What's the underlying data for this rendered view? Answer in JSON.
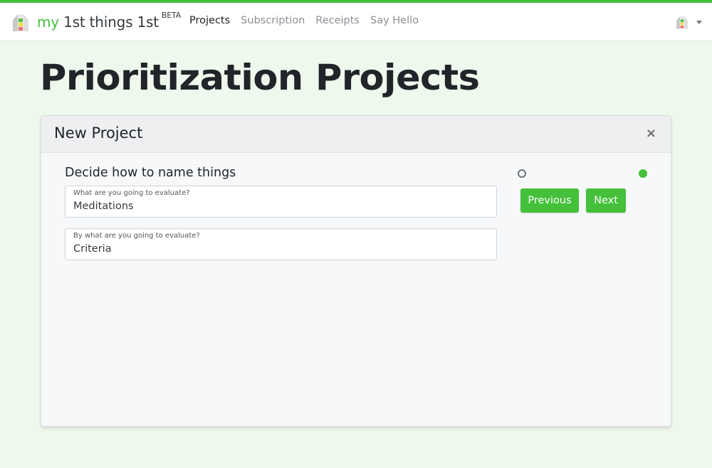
{
  "brand": {
    "prefix": "my",
    "name": " 1st things 1st",
    "badge": "BETA"
  },
  "nav": {
    "items": [
      {
        "label": "Projects",
        "active": true
      },
      {
        "label": "Subscription",
        "active": false
      },
      {
        "label": "Receipts",
        "active": false
      },
      {
        "label": "Say Hello",
        "active": false
      }
    ]
  },
  "colors": {
    "accent": "#44c03a",
    "page_bg": "#eef8ec",
    "logo_green": "#4cc441",
    "logo_yellow": "#f2dc3b",
    "logo_red": "#f07070"
  },
  "page": {
    "title": "Prioritization Projects"
  },
  "modal": {
    "title": "New Project",
    "close_label": "×",
    "step_heading": "Decide how to name things",
    "fields": [
      {
        "label": "What are you going to evaluate?",
        "value": "Meditations"
      },
      {
        "label": "By what are you going to evaluate?",
        "value": "Criteria"
      }
    ],
    "steps": {
      "total": 2,
      "current": 2
    },
    "buttons": {
      "previous": "Previous",
      "next": "Next"
    }
  }
}
